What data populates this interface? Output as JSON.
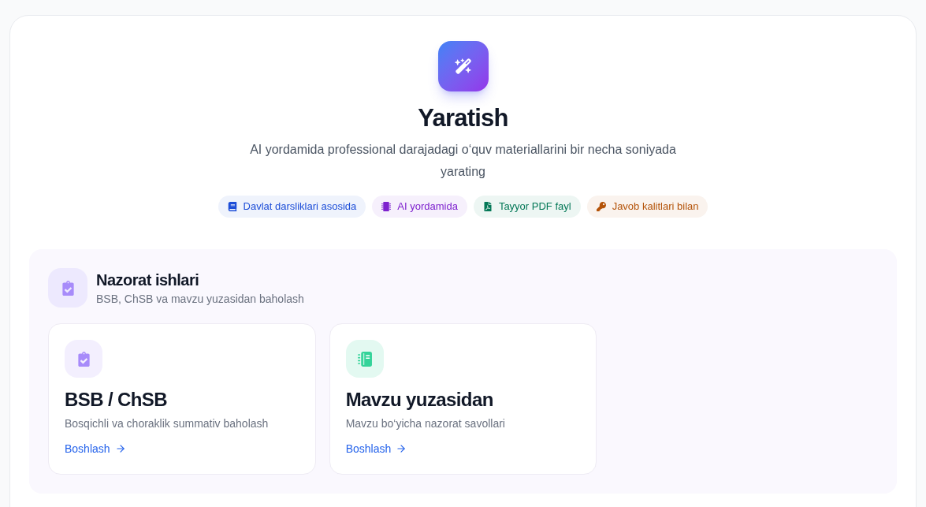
{
  "hero": {
    "title": "Yaratish",
    "subtitle": "AI yordamida professional darajadagi o‘quv materiallarini bir necha soniyada yarating",
    "badges": [
      {
        "label": "Davlat darsliklari asosida",
        "color": "#1d4ed8"
      },
      {
        "label": "AI yordamida",
        "color": "#7e22ce"
      },
      {
        "label": "Tayyor PDF fayl",
        "color": "#047857"
      },
      {
        "label": "Javob kalitlari bilan",
        "color": "#b45309"
      }
    ]
  },
  "section": {
    "title": "Nazorat ishlari",
    "subtitle": "BSB, ChSB va mavzu yuzasidan baholash",
    "cards": [
      {
        "title": "BSB / ChSB",
        "description": "Bosqichli va choraklik summativ baholash",
        "link": "Boshlash",
        "color": "#a78bfa"
      },
      {
        "title": "Mavzu yuzasidan",
        "description": "Mavzu bo‘yicha nazorat savollari",
        "link": "Boshlash",
        "color": "#34d399"
      }
    ]
  }
}
